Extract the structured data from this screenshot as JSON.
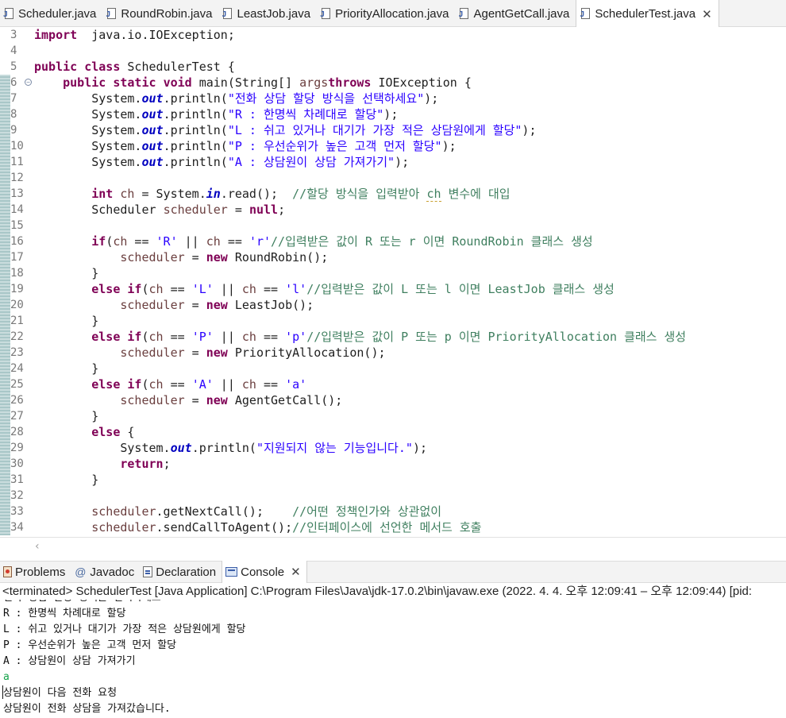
{
  "editor_tabs": [
    {
      "label": "Scheduler.java",
      "active": false
    },
    {
      "label": "RoundRobin.java",
      "active": false
    },
    {
      "label": "LeastJob.java",
      "active": false
    },
    {
      "label": "PriorityAllocation.java",
      "active": false
    },
    {
      "label": "AgentGetCall.java",
      "active": false
    },
    {
      "label": "SchedulerTest.java",
      "active": true,
      "closable": true
    }
  ],
  "code_lines": [
    {
      "n": "3",
      "segs": [
        [
          "kw",
          "import"
        ],
        [
          "",
          "  java.io.IOException;"
        ]
      ]
    },
    {
      "n": "4",
      "segs": []
    },
    {
      "n": "5",
      "segs": [
        [
          "kw",
          "public"
        ],
        [
          "",
          " "
        ],
        [
          "kw",
          "class"
        ],
        [
          "",
          " SchedulerTest {"
        ]
      ]
    },
    {
      "n": "6",
      "fold": true,
      "segs": [
        [
          "",
          "    "
        ],
        [
          "kw",
          "public"
        ],
        [
          "",
          " "
        ],
        [
          "kw",
          "static"
        ],
        [
          "",
          " "
        ],
        [
          "kw",
          "void"
        ],
        [
          "",
          " main(String[] "
        ],
        [
          "var",
          "args"
        ],
        [
          ") "
        ],
        [
          "kw",
          "throws"
        ],
        [
          "",
          " IOException {"
        ]
      ]
    },
    {
      "n": "7",
      "segs": [
        [
          "",
          "        System."
        ],
        [
          "fld",
          "out"
        ],
        [
          "",
          ".println("
        ],
        [
          "str",
          "\"전화 상담 할당 방식을 선택하세요\""
        ],
        [
          "",
          ");"
        ]
      ]
    },
    {
      "n": "8",
      "segs": [
        [
          "",
          "        System."
        ],
        [
          "fld",
          "out"
        ],
        [
          "",
          ".println("
        ],
        [
          "str",
          "\"R : 한명씩 차례대로 할당\""
        ],
        [
          "",
          ");"
        ]
      ]
    },
    {
      "n": "9",
      "segs": [
        [
          "",
          "        System."
        ],
        [
          "fld",
          "out"
        ],
        [
          "",
          ".println("
        ],
        [
          "str",
          "\"L : 쉬고 있거나 대기가 가장 적은 상담원에게 할당\""
        ],
        [
          "",
          ");"
        ]
      ]
    },
    {
      "n": "10",
      "segs": [
        [
          "",
          "        System."
        ],
        [
          "fld",
          "out"
        ],
        [
          "",
          ".println("
        ],
        [
          "str",
          "\"P : 우선순위가 높은 고객 먼저 할당\""
        ],
        [
          "",
          ");"
        ]
      ]
    },
    {
      "n": "11",
      "segs": [
        [
          "",
          "        System."
        ],
        [
          "fld",
          "out"
        ],
        [
          "",
          ".println("
        ],
        [
          "str",
          "\"A : 상담원이 상담 가져가기\""
        ],
        [
          "",
          ");"
        ]
      ]
    },
    {
      "n": "12",
      "segs": []
    },
    {
      "n": "13",
      "segs": [
        [
          "",
          "        "
        ],
        [
          "kw",
          "int"
        ],
        [
          "",
          " "
        ],
        [
          "var",
          "ch"
        ],
        [
          "",
          " = System."
        ],
        [
          "fld",
          "in"
        ],
        [
          "",
          ".read();  "
        ],
        [
          "cm",
          "//할당 방식을 입력받아 "
        ],
        [
          "cmsq",
          "ch"
        ],
        [
          "cm",
          " 변수에 대입"
        ]
      ]
    },
    {
      "n": "14",
      "segs": [
        [
          "",
          "        Scheduler "
        ],
        [
          "var",
          "scheduler"
        ],
        [
          "",
          " = "
        ],
        [
          "kw",
          "null"
        ],
        [
          "",
          ";"
        ]
      ]
    },
    {
      "n": "15",
      "segs": []
    },
    {
      "n": "16",
      "segs": [
        [
          "",
          "        "
        ],
        [
          "kw",
          "if"
        ],
        [
          "",
          "("
        ],
        [
          "var",
          "ch"
        ],
        [
          "",
          " == "
        ],
        [
          "str",
          "'R'"
        ],
        [
          "",
          " || "
        ],
        [
          "var",
          "ch"
        ],
        [
          "",
          " == "
        ],
        [
          "str",
          "'r'"
        ],
        [
          ") {    "
        ],
        [
          "cm",
          "//입력받은 값이 R 또는 r 이면 RoundRobin 클래스 생성"
        ]
      ]
    },
    {
      "n": "17",
      "segs": [
        [
          "",
          "            "
        ],
        [
          "var",
          "scheduler"
        ],
        [
          "",
          " = "
        ],
        [
          "kw",
          "new"
        ],
        [
          "",
          " RoundRobin();"
        ]
      ]
    },
    {
      "n": "18",
      "segs": [
        [
          "",
          "        }"
        ]
      ]
    },
    {
      "n": "19",
      "segs": [
        [
          "",
          "        "
        ],
        [
          "kw",
          "else"
        ],
        [
          "",
          " "
        ],
        [
          "kw",
          "if"
        ],
        [
          "",
          "("
        ],
        [
          "var",
          "ch"
        ],
        [
          "",
          " == "
        ],
        [
          "str",
          "'L'"
        ],
        [
          "",
          " || "
        ],
        [
          "var",
          "ch"
        ],
        [
          "",
          " == "
        ],
        [
          "str",
          "'l'"
        ],
        [
          ") { "
        ],
        [
          "cm",
          "//입력받은 값이 L 또는 l 이면 LeastJob 클래스 생성"
        ]
      ]
    },
    {
      "n": "20",
      "segs": [
        [
          "",
          "            "
        ],
        [
          "var",
          "scheduler"
        ],
        [
          "",
          " = "
        ],
        [
          "kw",
          "new"
        ],
        [
          "",
          " LeastJob();"
        ]
      ]
    },
    {
      "n": "21",
      "segs": [
        [
          "",
          "        }"
        ]
      ]
    },
    {
      "n": "22",
      "segs": [
        [
          "",
          "        "
        ],
        [
          "kw",
          "else"
        ],
        [
          "",
          " "
        ],
        [
          "kw",
          "if"
        ],
        [
          "",
          "("
        ],
        [
          "var",
          "ch"
        ],
        [
          "",
          " == "
        ],
        [
          "str",
          "'P'"
        ],
        [
          "",
          " || "
        ],
        [
          "var",
          "ch"
        ],
        [
          "",
          " == "
        ],
        [
          "str",
          "'p'"
        ],
        [
          ") {   "
        ],
        [
          "cm",
          "//입력받은 값이 P 또는 p 이면 PriorityAllocation 클래스 생성"
        ]
      ]
    },
    {
      "n": "23",
      "segs": [
        [
          "",
          "            "
        ],
        [
          "var",
          "scheduler"
        ],
        [
          "",
          " = "
        ],
        [
          "kw",
          "new"
        ],
        [
          "",
          " PriorityAllocation();"
        ]
      ]
    },
    {
      "n": "24",
      "segs": [
        [
          "",
          "        }"
        ]
      ]
    },
    {
      "n": "25",
      "segs": [
        [
          "",
          "        "
        ],
        [
          "kw",
          "else"
        ],
        [
          "",
          " "
        ],
        [
          "kw",
          "if"
        ],
        [
          "",
          "("
        ],
        [
          "var",
          "ch"
        ],
        [
          "",
          " == "
        ],
        [
          "str",
          "'A'"
        ],
        [
          "",
          " || "
        ],
        [
          "var",
          "ch"
        ],
        [
          "",
          " == "
        ],
        [
          "str",
          "'a'"
        ],
        [
          ") {"
        ]
      ]
    },
    {
      "n": "26",
      "segs": [
        [
          "",
          "            "
        ],
        [
          "var",
          "scheduler"
        ],
        [
          "",
          " = "
        ],
        [
          "kw",
          "new"
        ],
        [
          "",
          " AgentGetCall();"
        ]
      ]
    },
    {
      "n": "27",
      "segs": [
        [
          "",
          "        }"
        ]
      ]
    },
    {
      "n": "28",
      "segs": [
        [
          "",
          "        "
        ],
        [
          "kw",
          "else"
        ],
        [
          "",
          " {"
        ]
      ]
    },
    {
      "n": "29",
      "segs": [
        [
          "",
          "            System."
        ],
        [
          "fld",
          "out"
        ],
        [
          "",
          ".println("
        ],
        [
          "str",
          "\"지원되지 않는 기능입니다.\""
        ],
        [
          "",
          ");"
        ]
      ]
    },
    {
      "n": "30",
      "segs": [
        [
          "",
          "            "
        ],
        [
          "kw",
          "return"
        ],
        [
          "",
          ";"
        ]
      ]
    },
    {
      "n": "31",
      "segs": [
        [
          "",
          "        }"
        ]
      ]
    },
    {
      "n": "32",
      "segs": []
    },
    {
      "n": "33",
      "segs": [
        [
          "",
          "        "
        ],
        [
          "var",
          "scheduler"
        ],
        [
          "",
          ".getNextCall();    "
        ],
        [
          "cm",
          "//어떤 정책인가와 상관없이"
        ]
      ]
    },
    {
      "n": "34",
      "segs": [
        [
          "",
          "        "
        ],
        [
          "var",
          "scheduler"
        ],
        [
          "",
          ".sendCallToAgent();"
        ],
        [
          "cm",
          "//인터페이스에 선언한 메서드 호출"
        ]
      ]
    }
  ],
  "view_tabs": [
    {
      "label": "Problems",
      "icon": "problems-icon",
      "active": false
    },
    {
      "label": "Javadoc",
      "icon": "javadoc-icon",
      "active": false
    },
    {
      "label": "Declaration",
      "icon": "declaration-icon",
      "active": false
    },
    {
      "label": "Console",
      "icon": "console-icon",
      "active": true,
      "closable": true
    }
  ],
  "console": {
    "header": "<terminated> SchedulerTest [Java Application] C:\\Program Files\\Java\\jdk-17.0.2\\bin\\javaw.exe  (2022. 4. 4. 오후 12:09:41 – 오후 12:09:44) [pid:",
    "lines": [
      {
        "text": "전화 상담 할당 방식을 선택하세요",
        "type": "out"
      },
      {
        "text": "R : 한명씩 차례대로 할당",
        "type": "out"
      },
      {
        "text": "L : 쉬고 있거나 대기가 가장 적은 상담원에게 할당",
        "type": "out"
      },
      {
        "text": "P : 우선순위가 높은 고객 먼저 할당",
        "type": "out"
      },
      {
        "text": "A : 상담원이 상담 가져가기",
        "type": "out"
      },
      {
        "text": "a",
        "type": "input"
      },
      {
        "text": "상담원이 다음 전화 요청",
        "type": "out"
      },
      {
        "text": "상담원이 전화 상담을 가져갔습니다.",
        "type": "out"
      }
    ]
  },
  "colors": {
    "keyword": "#7f0055",
    "string": "#2a00ff",
    "comment": "#3f7f5f",
    "static_field": "#0000c0",
    "local_variable": "#6a3e3e",
    "console_input": "#16a34a"
  }
}
